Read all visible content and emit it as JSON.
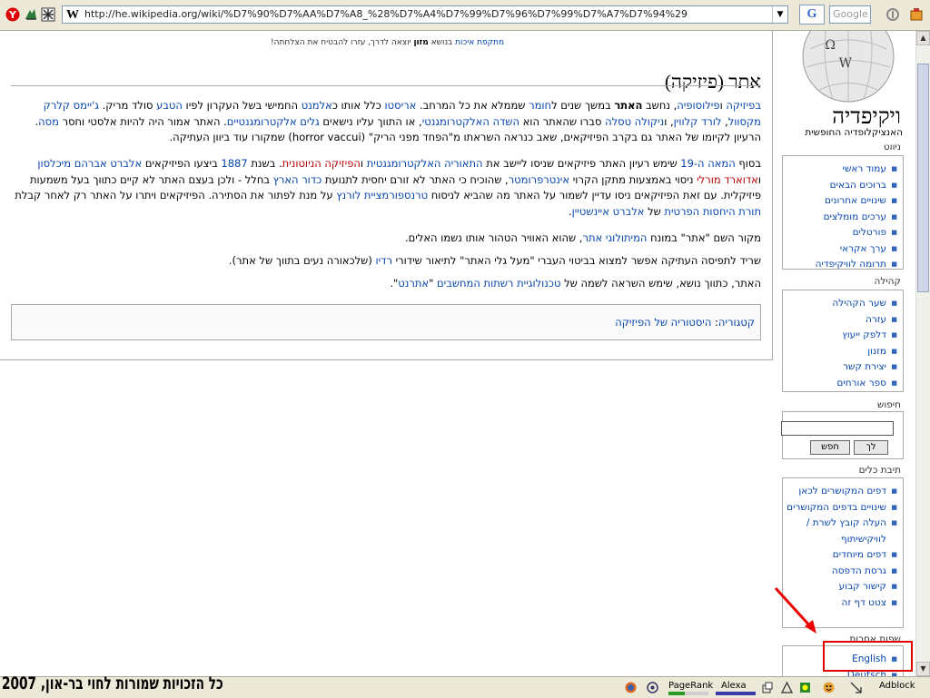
{
  "browser": {
    "url": "http://he.wikipedia.org/wiki/%D7%90%D7%AA%D7%A8_%28%D7%A4%D7%99%D7%96%D7%99%D7%A7%D7%94%29",
    "search_placeholder": "Google",
    "icons": [
      "y-button-icon",
      "delicious-icon",
      "settings-icon",
      "wikipedia-favicon",
      "google-search-icon",
      "pagerank-icon",
      "toolbar-menu-icon"
    ]
  },
  "article": {
    "site_notice_link": "מתקפת איכות",
    "site_notice_mid": " בנושא ",
    "site_notice_bold": "מזון",
    "site_notice_rest": " יוצאה לדרך, עזרו להבטיח את הצלחתה!",
    "title": "אתר (פיזיקה)",
    "p1": [
      {
        "t": "בפיזיקה",
        "l": 1
      },
      {
        "t": " ו",
        "l": 0
      },
      {
        "t": "פילוסופיה",
        "l": 1
      },
      {
        "t": ", נחשב ",
        "l": 0
      },
      {
        "t": "האתר",
        "b": 1
      },
      {
        "t": " במשך שנים ל",
        "l": 0
      },
      {
        "t": "חומר",
        "l": 1
      },
      {
        "t": " שממלא את כל המרחב. ",
        "l": 0
      },
      {
        "t": "אריסטו",
        "l": 1
      },
      {
        "t": " כלל אותו כ",
        "l": 0
      },
      {
        "t": "אלמנט",
        "l": 1
      },
      {
        "t": " החמישי בשל העקרון לפיו ",
        "l": 0
      },
      {
        "t": "הטבע",
        "l": 1
      },
      {
        "t": " סולד מריק. ",
        "l": 0
      },
      {
        "t": "ג'יימס קלרק מקסוול",
        "l": 1
      },
      {
        "t": ", ",
        "l": 0
      },
      {
        "t": "לורד קלווין",
        "l": 1
      },
      {
        "t": ", ו",
        "l": 0
      },
      {
        "t": "ניקולה טסלה",
        "l": 1
      },
      {
        "t": " סברו שהאתר הוא ",
        "l": 0
      },
      {
        "t": "השדה האלקטרומגנטי",
        "l": 1
      },
      {
        "t": ", או התווך עליו נישאים ",
        "l": 0
      },
      {
        "t": "גלים אלקטרומגנטיים",
        "l": 1
      },
      {
        "t": ". האתר אמור היה להיות אלסטי וחסר ",
        "l": 0
      },
      {
        "t": "מסה",
        "l": 1
      },
      {
        "t": ". הרעיון לקיומו של האתר גם בקרב הפיזיקאים, שאב כנראה השראתו מ\"הפחד מפני הריק\" (horror vaccui) שמקורו עוד ביוון העתיקה.",
        "l": 0
      }
    ],
    "p2": [
      {
        "t": "בסוף ",
        "l": 0
      },
      {
        "t": "המאה ה-19",
        "l": 1
      },
      {
        "t": " שימש רעיון האתר פיזיקאים שניסו ליישב את ",
        "l": 0
      },
      {
        "t": "התאוריה האלקטרומגנטית",
        "l": 1
      },
      {
        "t": " ו",
        "l": 0
      },
      {
        "t": "הפיזיקה הניוטונית",
        "r": 1
      },
      {
        "t": ". בשנת ",
        "l": 0
      },
      {
        "t": "1887",
        "l": 1
      },
      {
        "t": " ביצעו הפיזיקאים ",
        "l": 0
      },
      {
        "t": "אלברט אברהם מיכלסון",
        "l": 1
      },
      {
        "t": " ו",
        "l": 0
      },
      {
        "t": "אדוארד מורלי",
        "r": 1
      },
      {
        "t": " ניסוי באמצעות מתקן הקרוי ",
        "l": 0
      },
      {
        "t": "אינטרפרומטר",
        "l": 1
      },
      {
        "t": ", שהוכיח כי האתר לא זורם יחסית לתנועת ",
        "l": 0
      },
      {
        "t": "כדור הארץ",
        "l": 1
      },
      {
        "t": " בחלל - ולכן בעצם האתר לא קיים כתווך בעל משמעות פיזיקלית. עם זאת הפיזיקאים ניסו עדיין לשמור על האתר מה שהביא לניסוח ",
        "l": 0
      },
      {
        "t": "טרנספורמציית לורנץ",
        "l": 1
      },
      {
        "t": " על מנת לפתור את הסתירה. הפיזיקאים ויתרו על האתר רק לאחר קבלת ",
        "l": 0
      },
      {
        "t": "תורת היחסות הפרטית",
        "l": 1
      },
      {
        "t": " של ",
        "l": 0
      },
      {
        "t": "אלברט איינשטיין",
        "l": 1
      },
      {
        "t": ".",
        "l": 0
      }
    ],
    "p3": [
      {
        "t": "מקור השם \"אתר\" במונח ",
        "l": 0
      },
      {
        "t": "המיתולוגי",
        "l": 1
      },
      {
        "t": " ",
        "l": 0
      },
      {
        "t": "אתר",
        "l": 1
      },
      {
        "t": ", שהוא האוויר הטהור אותו נשמו האלים.",
        "l": 0
      }
    ],
    "p4": [
      {
        "t": "שריד לתפיסה העתיקה אפשר למצוא בביטוי העברי \"מעל גלי האתר\" לתיאור שידורי ",
        "l": 0
      },
      {
        "t": "רדיו",
        "l": 1
      },
      {
        "t": " (שלכאורה נעים בתווך של אתר).",
        "l": 0
      }
    ],
    "p5": [
      {
        "t": "האתר, כתווך נושא, שימש השראה לשמה של ",
        "l": 0
      },
      {
        "t": "טכנולוגיית רשתות המחשבים",
        "l": 1
      },
      {
        "t": " \"",
        "l": 0
      },
      {
        "t": "אתרנט",
        "l": 1
      },
      {
        "t": "\".",
        "l": 0
      }
    ],
    "category_label": "קטגוריה",
    "category_sep": ": ",
    "category_link": "היסטוריה של הפיזיקה"
  },
  "sidebar": {
    "logo_title": "ויקיפדיה",
    "logo_subtitle": "האנציקלופדיה החופשית",
    "nav_heading": "ניווט",
    "nav_items": [
      "עמוד ראשי",
      "ברוכים הבאים",
      "שינויים אחרונים",
      "ערכים מומלצים",
      "פורטלים",
      "ערך אקראי",
      "תרומה לוויקיפדיה"
    ],
    "community_heading": "קהילה",
    "community_items": [
      "שער הקהילה",
      "עזרה",
      "דלפק ייעוץ",
      "מזנון",
      "יצירת קשר",
      "ספר אורחים"
    ],
    "search_heading": "חיפוש",
    "search_go": "לך",
    "search_search": "חפש",
    "toolbox_heading": "תיבת כלים",
    "toolbox_items": [
      "דפים המקושרים לכאן",
      "שינויים בדפים המקושרים",
      "העלה קובץ לשרת / לוויקישיתוף",
      "דפים מיוחדים",
      "גרסת הדפסה",
      "קישור קבוע",
      "צטט דף זה"
    ],
    "lang_heading": "שפות אחרות",
    "lang_items": [
      "English",
      "Deutsch"
    ]
  },
  "status": {
    "copyright": "כל הזכויות שמורות לחוי בר-און, 2007",
    "pagerank": "PageRank",
    "alexa": "Alexa",
    "adblock": "Adblock"
  },
  "annotation": {
    "highlight_color": "#e00000"
  }
}
